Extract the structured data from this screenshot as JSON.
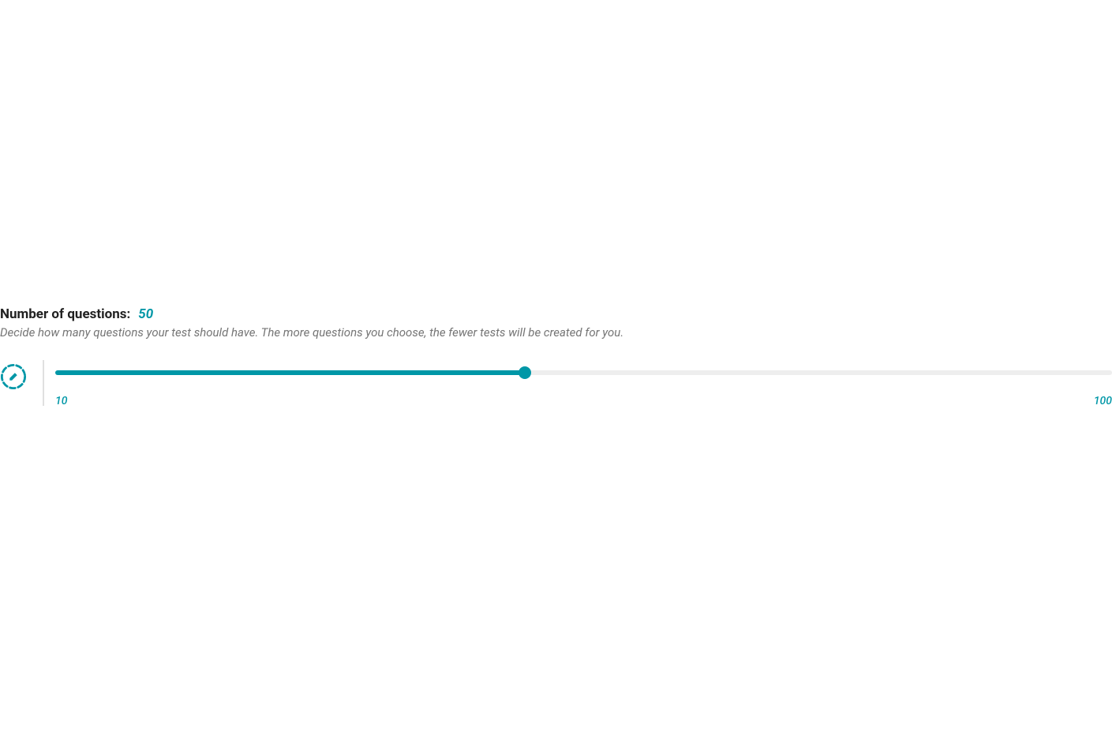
{
  "colors": {
    "accent": "#0097a7",
    "text_primary": "#212121",
    "text_secondary": "#757575",
    "track_bg": "#eeeeee"
  },
  "heading": {
    "label": "Number of questions:",
    "value": "50"
  },
  "description": "Decide how many questions your test should have. The more questions you choose, the fewer tests will be created for you.",
  "slider": {
    "min_label": "10",
    "max_label": "100",
    "min": 10,
    "max": 100,
    "current": 50,
    "fill_percent": "44.44%"
  },
  "icons": {
    "edit_circle": "edit-circle-dashed"
  }
}
